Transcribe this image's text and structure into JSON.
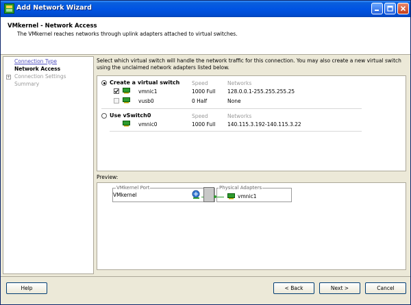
{
  "window": {
    "title": "Add Network Wizard"
  },
  "header": {
    "title": "VMkernel - Network Access",
    "subtitle": "The VMkernel reaches networks through uplink adapters attached to virtual switches."
  },
  "nav": {
    "items": [
      {
        "label": "Connection Type",
        "state": "link"
      },
      {
        "label": "Network Access",
        "state": "active"
      },
      {
        "label": "Connection Settings",
        "state": "disabled",
        "expandable": true
      },
      {
        "label": "Summary",
        "state": "disabled"
      }
    ]
  },
  "content": {
    "description": "Select which virtual switch will handle the network traffic for this connection. You may also create a new virtual switch using the unclaimed network adapters listed below.",
    "create_option": {
      "label": "Create a virtual switch",
      "selected": true,
      "col_speed": "Speed",
      "col_networks": "Networks",
      "adapters": [
        {
          "name": "vmnic1",
          "speed": "1000 Full",
          "networks": "128.0.0.1-255.255.255.25",
          "checked": true
        },
        {
          "name": "vusb0",
          "speed": "0 Half",
          "networks": "None",
          "checked": false
        }
      ]
    },
    "existing_option": {
      "label": "Use vSwitch0",
      "selected": false,
      "col_speed": "Speed",
      "col_networks": "Networks",
      "adapters": [
        {
          "name": "vmnic0",
          "speed": "1000 Full",
          "networks": "140.115.3.192-140.115.3.22"
        }
      ]
    }
  },
  "preview": {
    "label": "Preview:",
    "port_group_legend": "VMkernel Port",
    "port_name": "VMkernel",
    "adapters_legend": "Physical Adapters",
    "adapter_name": "vmnic1"
  },
  "buttons": {
    "help": "Help",
    "back": "< Back",
    "next": "Next >",
    "cancel": "Cancel"
  },
  "colors": {
    "titlebar": "#0054e3",
    "nic_green": "#2e9b2e",
    "link": "#5050c0"
  }
}
